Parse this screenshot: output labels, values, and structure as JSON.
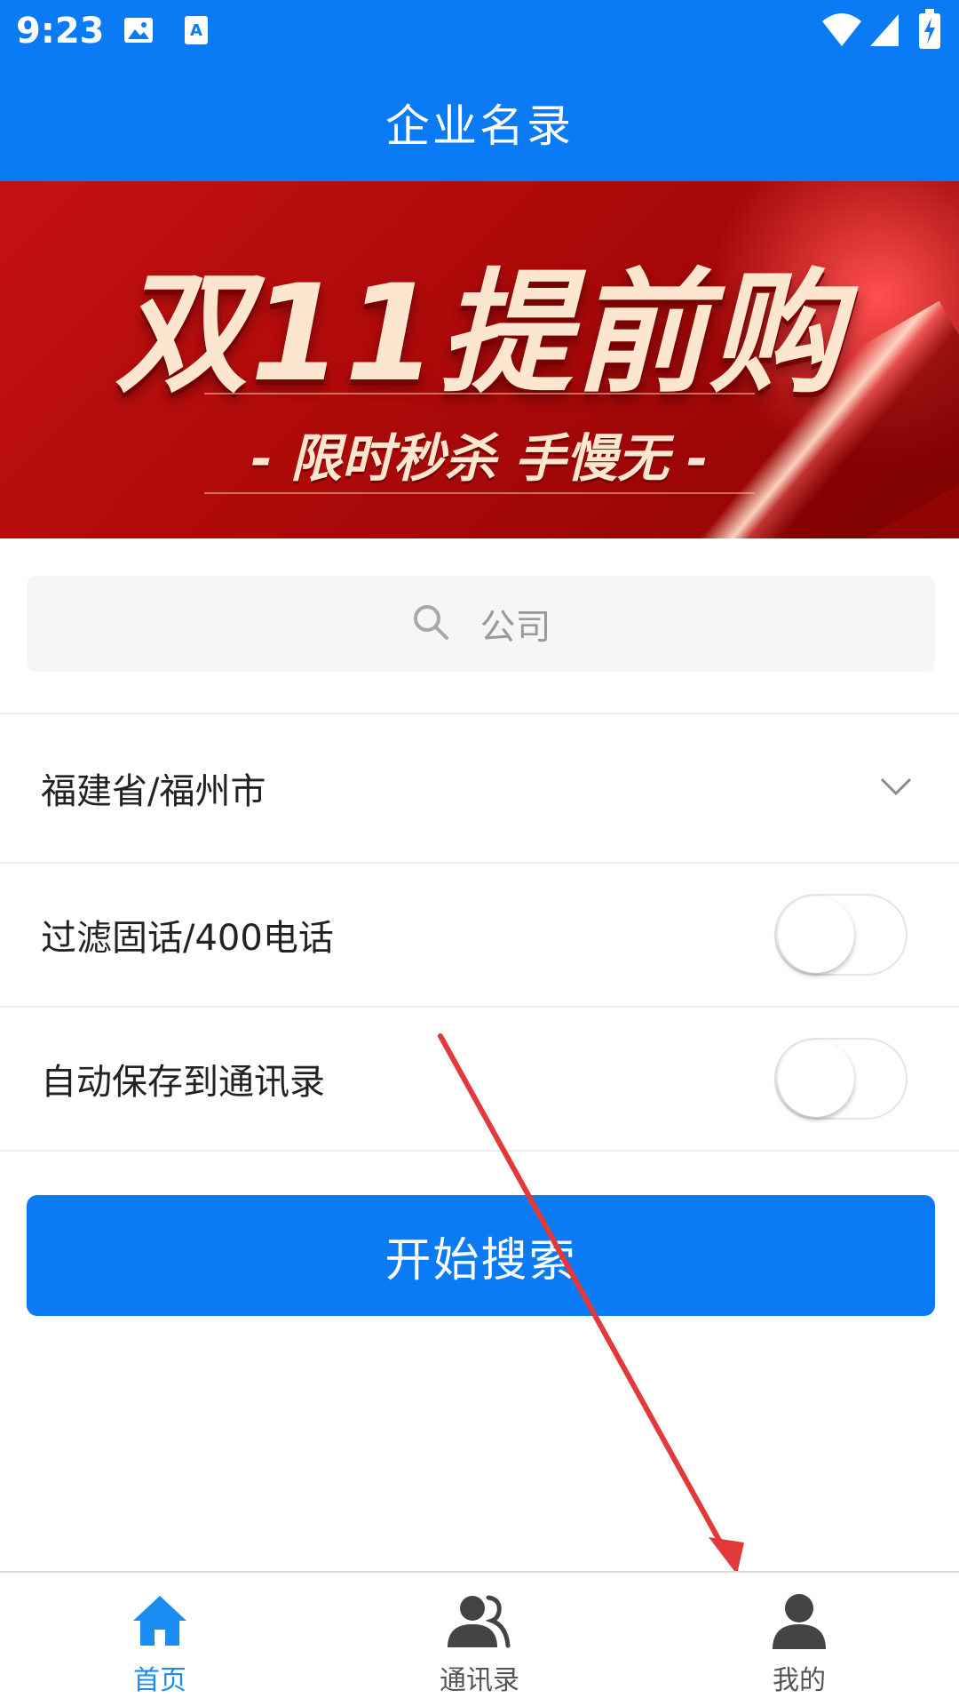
{
  "status_bar": {
    "time": "9:23",
    "icons": [
      "image-notification-icon",
      "keyboard-notification-icon",
      "wifi-icon",
      "signal-icon",
      "battery-charging-icon"
    ]
  },
  "app_bar": {
    "title": "企业名录"
  },
  "banner": {
    "headline": "双11提前购",
    "subline": "- 限时秒杀 手慢无 -",
    "colors": {
      "background": "#b00a0a",
      "text": "#fde6cf"
    }
  },
  "search": {
    "placeholder": "公司",
    "icon": "search-icon"
  },
  "region": {
    "value": "福建省/福州市",
    "icon": "chevron-down-icon"
  },
  "filters": [
    {
      "label": "过滤固话/400电话",
      "enabled": false
    },
    {
      "label": "自动保存到通讯录",
      "enabled": false
    }
  ],
  "start_button": {
    "label": "开始搜索"
  },
  "bottom_nav": {
    "items": [
      {
        "label": "首页",
        "icon": "home-icon",
        "active": true
      },
      {
        "label": "通讯录",
        "icon": "contacts-icon",
        "active": false
      },
      {
        "label": "我的",
        "icon": "profile-icon",
        "active": false
      }
    ]
  },
  "colors": {
    "primary": "#0a7af5",
    "annotation_arrow": "#e23a3a",
    "inactive_icon": "#444444"
  }
}
